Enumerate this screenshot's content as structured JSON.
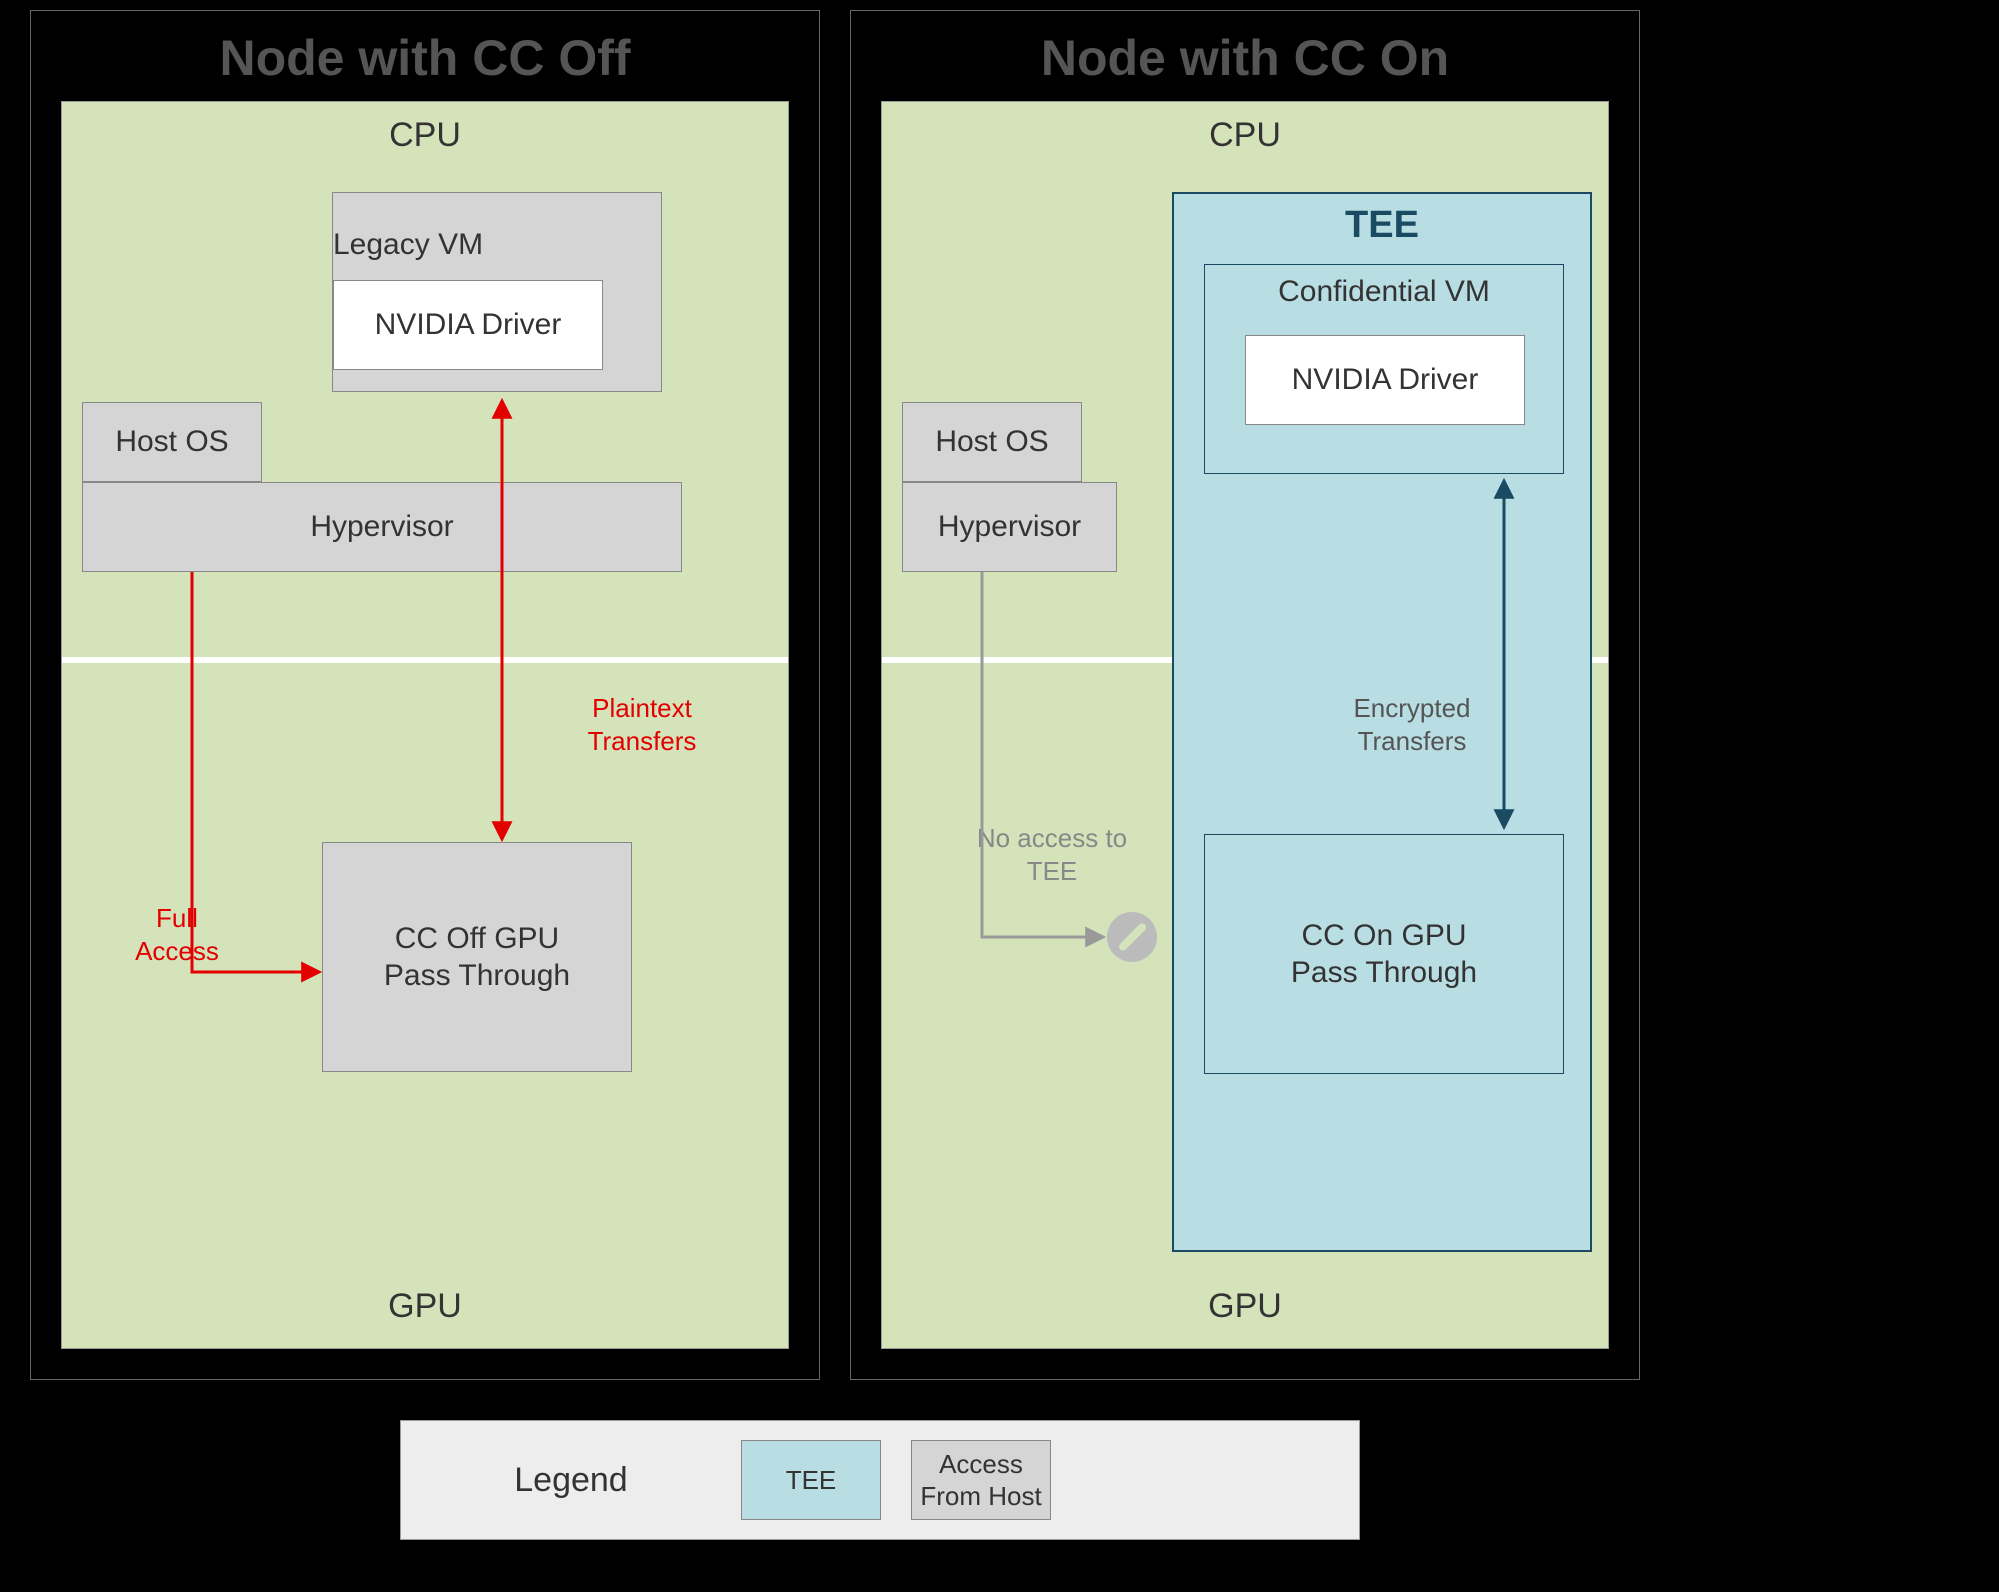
{
  "left": {
    "title": "Node with CC Off",
    "cpu": "CPU",
    "gpu": "GPU",
    "host_os": "Host OS",
    "hypervisor": "Hypervisor",
    "vm_title": "Legacy VM",
    "driver": "NVIDIA Driver",
    "gpu_box": "CC Off GPU Pass Through",
    "full_access": "Full Access",
    "plaintext": "Plaintext Transfers"
  },
  "right": {
    "title": "Node with CC On",
    "cpu": "CPU",
    "gpu": "GPU",
    "host_os": "Host OS",
    "hypervisor": "Hypervisor",
    "tee_title": "TEE",
    "vm_title": "Confidential VM",
    "driver": "NVIDIA Driver",
    "gpu_box": "CC On GPU Pass Through",
    "no_access": "No access to TEE",
    "encrypted": "Encrypted Transfers"
  },
  "legend": {
    "title": "Legend",
    "tee": "TEE",
    "host": "Access From Host"
  },
  "colors": {
    "green": "#d5e3bb",
    "gray": "#d5d5d5",
    "teal": "#b8dde2",
    "darkblue": "#1b4a63",
    "red": "#e20000"
  }
}
